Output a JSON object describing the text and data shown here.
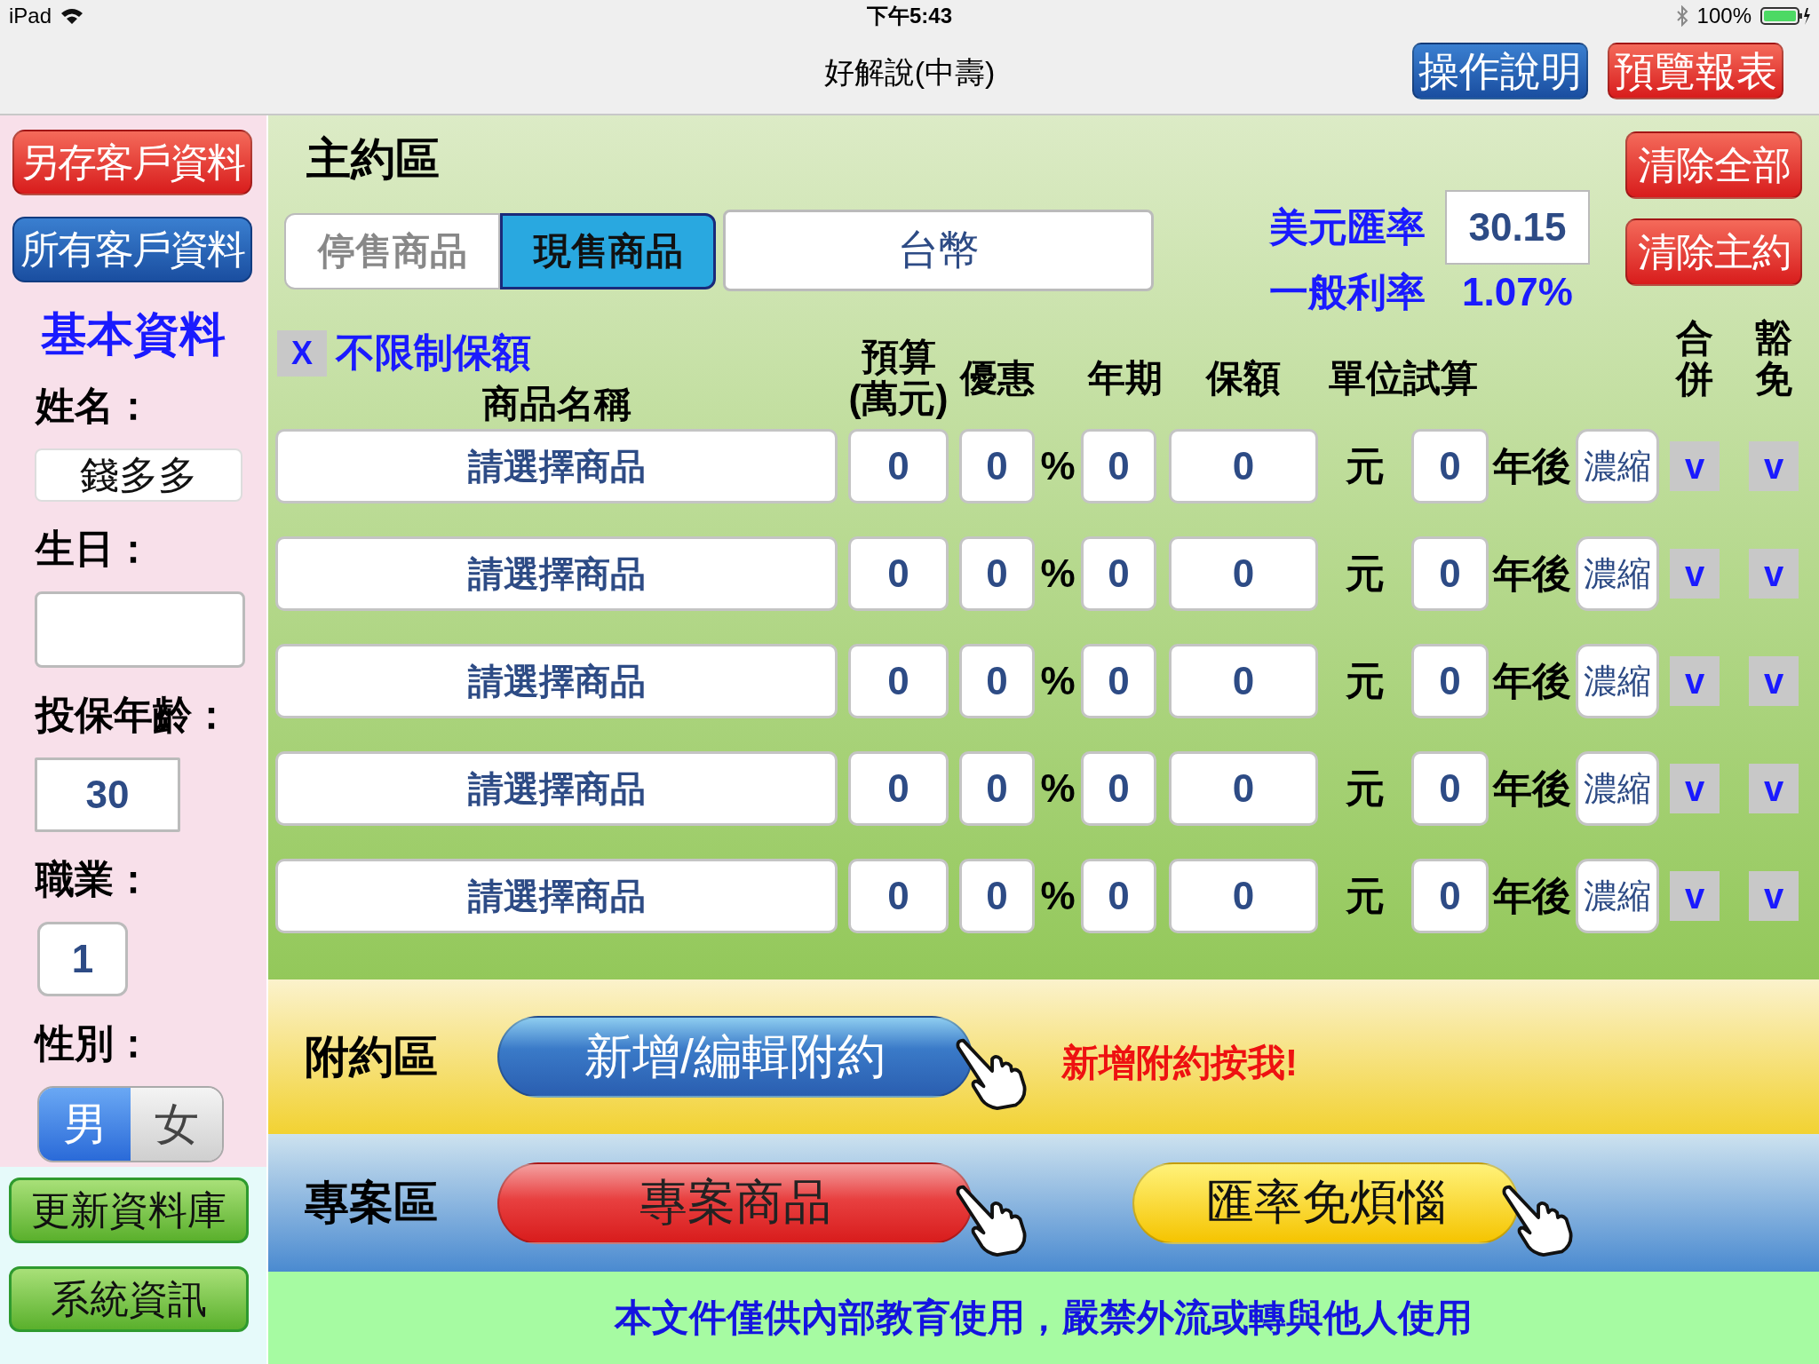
{
  "status_bar": {
    "device": "iPad",
    "time": "下午5:43",
    "battery": "100%"
  },
  "nav": {
    "title": "好解說(中壽)",
    "buttons": [
      {
        "label": "操作說明",
        "kind": "blue"
      },
      {
        "label": "預覽報表",
        "kind": "red"
      }
    ]
  },
  "sidebar": {
    "top_buttons": [
      {
        "label": "另存客戶資料",
        "kind": "red"
      },
      {
        "label": "所有客戶資料",
        "kind": "blue"
      }
    ],
    "section_title": "基本資料",
    "fields": [
      {
        "label": "姓名：",
        "value": "錢多多"
      },
      {
        "label": "生日："
      },
      {
        "label": "投保年齡：",
        "value": "30"
      },
      {
        "label": "職業：",
        "value": "1"
      }
    ],
    "gender": {
      "label": "性別：",
      "options": [
        {
          "label": "男",
          "selected": true
        },
        {
          "label": "女",
          "selected": false
        }
      ]
    },
    "bottom_buttons": [
      {
        "label": "更新資料庫",
        "kind": "green"
      },
      {
        "label": "系統資訊",
        "kind": "green"
      }
    ]
  },
  "main": {
    "title": "主約區",
    "product_tabs": [
      {
        "label": "停售商品",
        "selected": false
      },
      {
        "label": "現售商品",
        "selected": true
      }
    ],
    "currency": "台幣",
    "usd_rate_label": "美元匯率",
    "usd_rate": "30.15",
    "interest_label": "一般利率",
    "interest": "1.07%",
    "clear_buttons": [
      "清除全部",
      "清除主約"
    ],
    "unlimited": {
      "mark": "X",
      "label": "不限制保額",
      "checked": true
    },
    "columns": [
      "商品名稱",
      "預算(萬元)",
      "優惠",
      "年期",
      "保額",
      "單位試算",
      "合併",
      "豁免"
    ],
    "rows": [
      {
        "product": "請選擇商品",
        "budget": "0",
        "discount": "0",
        "percent": "%",
        "term": "0",
        "amount": "0",
        "unit": "元",
        "trial": "0",
        "after": "年後",
        "condense": "濃縮",
        "merge": "v",
        "waiver": "v"
      },
      {
        "product": "請選擇商品",
        "budget": "0",
        "discount": "0",
        "percent": "%",
        "term": "0",
        "amount": "0",
        "unit": "元",
        "trial": "0",
        "after": "年後",
        "condense": "濃縮",
        "merge": "v",
        "waiver": "v"
      },
      {
        "product": "請選擇商品",
        "budget": "0",
        "discount": "0",
        "percent": "%",
        "term": "0",
        "amount": "0",
        "unit": "元",
        "trial": "0",
        "after": "年後",
        "condense": "濃縮",
        "merge": "v",
        "waiver": "v"
      },
      {
        "product": "請選擇商品",
        "budget": "0",
        "discount": "0",
        "percent": "%",
        "term": "0",
        "amount": "0",
        "unit": "元",
        "trial": "0",
        "after": "年後",
        "condense": "濃縮",
        "merge": "v",
        "waiver": "v"
      },
      {
        "product": "請選擇商品",
        "budget": "0",
        "discount": "0",
        "percent": "%",
        "term": "0",
        "amount": "0",
        "unit": "元",
        "trial": "0",
        "after": "年後",
        "condense": "濃縮",
        "merge": "v",
        "waiver": "v"
      }
    ]
  },
  "rider": {
    "title": "附約區",
    "button": "新增/編輯附約",
    "hint": "新增附約按我!"
  },
  "project": {
    "title": "專案區",
    "buttons": [
      {
        "label": "專案商品",
        "kind": "red"
      },
      {
        "label": "匯率免煩惱",
        "kind": "yellow"
      }
    ]
  },
  "footer": "本文件僅供內部教育使用，嚴禁外流或轉與他人使用"
}
